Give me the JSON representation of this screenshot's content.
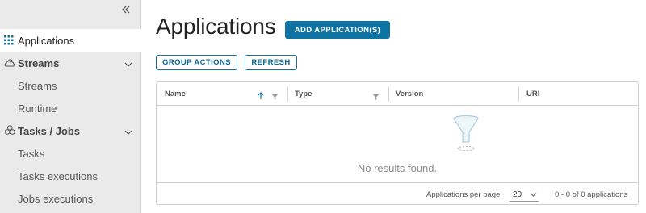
{
  "sidebar": {
    "collapse_icon": "double-chevron-left-icon",
    "items": [
      {
        "label": "Applications",
        "icon": "grid-icon",
        "type": "item",
        "active": true
      },
      {
        "label": "Streams",
        "icon": "clouds-icon",
        "type": "group"
      },
      {
        "label": "Streams",
        "type": "sub"
      },
      {
        "label": "Runtime",
        "type": "sub"
      },
      {
        "label": "Tasks / Jobs",
        "icon": "tasks-icon",
        "type": "group"
      },
      {
        "label": "Tasks",
        "type": "sub"
      },
      {
        "label": "Tasks executions",
        "type": "sub"
      },
      {
        "label": "Jobs executions",
        "type": "sub"
      }
    ]
  },
  "main": {
    "title": "Applications",
    "add_button": "ADD APPLICATION(S)",
    "group_actions_button": "GROUP ACTIONS",
    "refresh_button": "REFRESH"
  },
  "grid": {
    "columns": [
      {
        "label": "Name",
        "sorted": "ascending",
        "filter": true
      },
      {
        "label": "Type",
        "filter": true
      },
      {
        "label": "Version"
      },
      {
        "label": "URI"
      }
    ],
    "empty_message": "No results found.",
    "footer": {
      "per_page_label": "Applications per page",
      "per_page_value": "20",
      "range_text": "0 - 0 of 0 applications"
    }
  },
  "colors": {
    "accent": "#0e72a3",
    "sidebar_bg": "#eaeaea"
  }
}
